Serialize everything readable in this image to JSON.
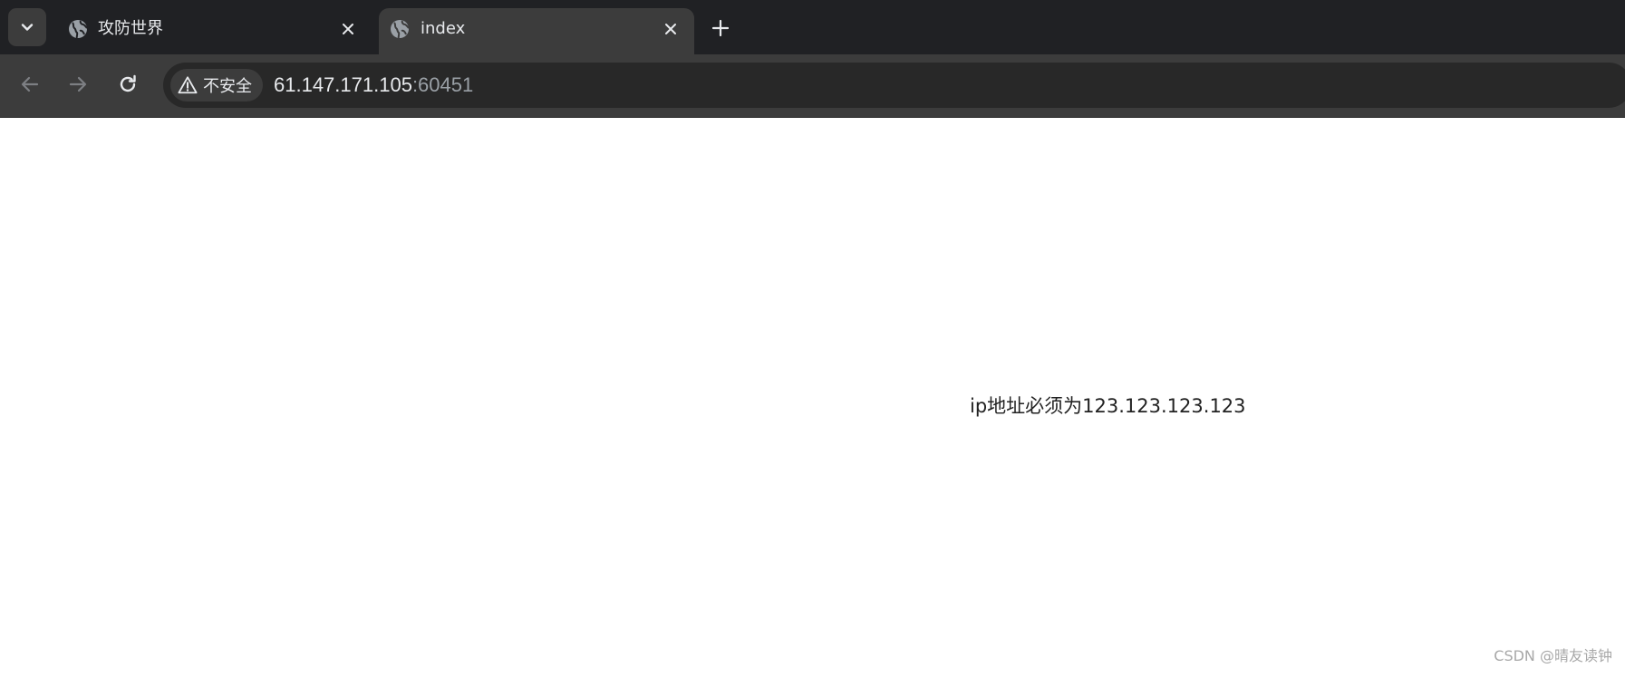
{
  "browser": {
    "tabs": [
      {
        "title": "攻防世界",
        "active": false,
        "icon": "globe-icon"
      },
      {
        "title": "index",
        "active": true,
        "icon": "globe-icon"
      }
    ],
    "tab_search_icon": "chevron-down-icon",
    "new_tab_icon": "plus-icon",
    "close_icon": "close-icon"
  },
  "toolbar": {
    "back_icon": "arrow-left-icon",
    "forward_icon": "arrow-right-icon",
    "reload_icon": "reload-icon",
    "security": {
      "icon": "warning-icon",
      "label": "不安全"
    },
    "url": {
      "host": "61.147.171.105",
      "port": ":60451"
    }
  },
  "page": {
    "message": "ip地址必须为123.123.123.123",
    "watermark": "CSDN @晴友读钟"
  },
  "colors": {
    "tabstrip_bg": "#202124",
    "toolbar_bg": "#3c3c3c",
    "omnibox_bg": "#282828",
    "text_light": "#e8eaed",
    "text_muted": "#9aa0a6",
    "page_bg": "#ffffff"
  }
}
